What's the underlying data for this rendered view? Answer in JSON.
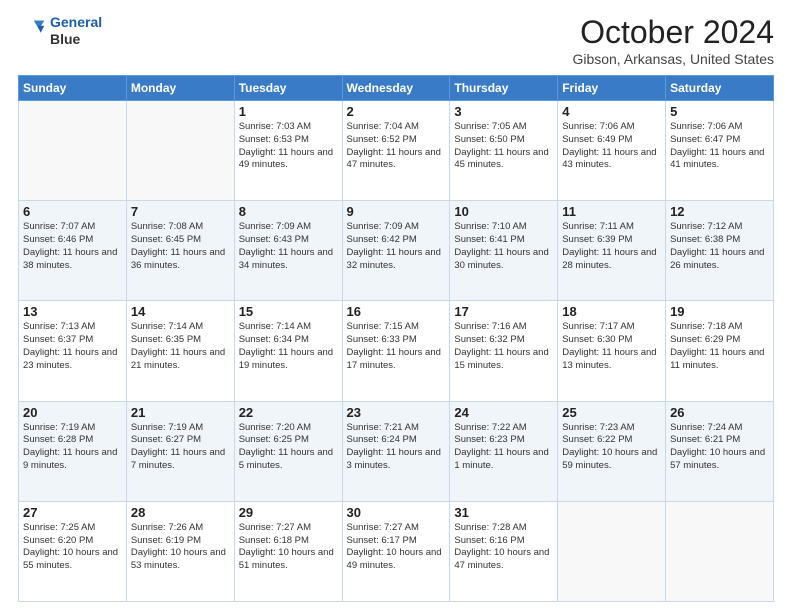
{
  "header": {
    "logo_line1": "General",
    "logo_line2": "Blue",
    "month": "October 2024",
    "location": "Gibson, Arkansas, United States"
  },
  "weekdays": [
    "Sunday",
    "Monday",
    "Tuesday",
    "Wednesday",
    "Thursday",
    "Friday",
    "Saturday"
  ],
  "weeks": [
    [
      {
        "day": "",
        "info": ""
      },
      {
        "day": "",
        "info": ""
      },
      {
        "day": "1",
        "info": "Sunrise: 7:03 AM\nSunset: 6:53 PM\nDaylight: 11 hours and 49 minutes."
      },
      {
        "day": "2",
        "info": "Sunrise: 7:04 AM\nSunset: 6:52 PM\nDaylight: 11 hours and 47 minutes."
      },
      {
        "day": "3",
        "info": "Sunrise: 7:05 AM\nSunset: 6:50 PM\nDaylight: 11 hours and 45 minutes."
      },
      {
        "day": "4",
        "info": "Sunrise: 7:06 AM\nSunset: 6:49 PM\nDaylight: 11 hours and 43 minutes."
      },
      {
        "day": "5",
        "info": "Sunrise: 7:06 AM\nSunset: 6:47 PM\nDaylight: 11 hours and 41 minutes."
      }
    ],
    [
      {
        "day": "6",
        "info": "Sunrise: 7:07 AM\nSunset: 6:46 PM\nDaylight: 11 hours and 38 minutes."
      },
      {
        "day": "7",
        "info": "Sunrise: 7:08 AM\nSunset: 6:45 PM\nDaylight: 11 hours and 36 minutes."
      },
      {
        "day": "8",
        "info": "Sunrise: 7:09 AM\nSunset: 6:43 PM\nDaylight: 11 hours and 34 minutes."
      },
      {
        "day": "9",
        "info": "Sunrise: 7:09 AM\nSunset: 6:42 PM\nDaylight: 11 hours and 32 minutes."
      },
      {
        "day": "10",
        "info": "Sunrise: 7:10 AM\nSunset: 6:41 PM\nDaylight: 11 hours and 30 minutes."
      },
      {
        "day": "11",
        "info": "Sunrise: 7:11 AM\nSunset: 6:39 PM\nDaylight: 11 hours and 28 minutes."
      },
      {
        "day": "12",
        "info": "Sunrise: 7:12 AM\nSunset: 6:38 PM\nDaylight: 11 hours and 26 minutes."
      }
    ],
    [
      {
        "day": "13",
        "info": "Sunrise: 7:13 AM\nSunset: 6:37 PM\nDaylight: 11 hours and 23 minutes."
      },
      {
        "day": "14",
        "info": "Sunrise: 7:14 AM\nSunset: 6:35 PM\nDaylight: 11 hours and 21 minutes."
      },
      {
        "day": "15",
        "info": "Sunrise: 7:14 AM\nSunset: 6:34 PM\nDaylight: 11 hours and 19 minutes."
      },
      {
        "day": "16",
        "info": "Sunrise: 7:15 AM\nSunset: 6:33 PM\nDaylight: 11 hours and 17 minutes."
      },
      {
        "day": "17",
        "info": "Sunrise: 7:16 AM\nSunset: 6:32 PM\nDaylight: 11 hours and 15 minutes."
      },
      {
        "day": "18",
        "info": "Sunrise: 7:17 AM\nSunset: 6:30 PM\nDaylight: 11 hours and 13 minutes."
      },
      {
        "day": "19",
        "info": "Sunrise: 7:18 AM\nSunset: 6:29 PM\nDaylight: 11 hours and 11 minutes."
      }
    ],
    [
      {
        "day": "20",
        "info": "Sunrise: 7:19 AM\nSunset: 6:28 PM\nDaylight: 11 hours and 9 minutes."
      },
      {
        "day": "21",
        "info": "Sunrise: 7:19 AM\nSunset: 6:27 PM\nDaylight: 11 hours and 7 minutes."
      },
      {
        "day": "22",
        "info": "Sunrise: 7:20 AM\nSunset: 6:25 PM\nDaylight: 11 hours and 5 minutes."
      },
      {
        "day": "23",
        "info": "Sunrise: 7:21 AM\nSunset: 6:24 PM\nDaylight: 11 hours and 3 minutes."
      },
      {
        "day": "24",
        "info": "Sunrise: 7:22 AM\nSunset: 6:23 PM\nDaylight: 11 hours and 1 minute."
      },
      {
        "day": "25",
        "info": "Sunrise: 7:23 AM\nSunset: 6:22 PM\nDaylight: 10 hours and 59 minutes."
      },
      {
        "day": "26",
        "info": "Sunrise: 7:24 AM\nSunset: 6:21 PM\nDaylight: 10 hours and 57 minutes."
      }
    ],
    [
      {
        "day": "27",
        "info": "Sunrise: 7:25 AM\nSunset: 6:20 PM\nDaylight: 10 hours and 55 minutes."
      },
      {
        "day": "28",
        "info": "Sunrise: 7:26 AM\nSunset: 6:19 PM\nDaylight: 10 hours and 53 minutes."
      },
      {
        "day": "29",
        "info": "Sunrise: 7:27 AM\nSunset: 6:18 PM\nDaylight: 10 hours and 51 minutes."
      },
      {
        "day": "30",
        "info": "Sunrise: 7:27 AM\nSunset: 6:17 PM\nDaylight: 10 hours and 49 minutes."
      },
      {
        "day": "31",
        "info": "Sunrise: 7:28 AM\nSunset: 6:16 PM\nDaylight: 10 hours and 47 minutes."
      },
      {
        "day": "",
        "info": ""
      },
      {
        "day": "",
        "info": ""
      }
    ]
  ]
}
